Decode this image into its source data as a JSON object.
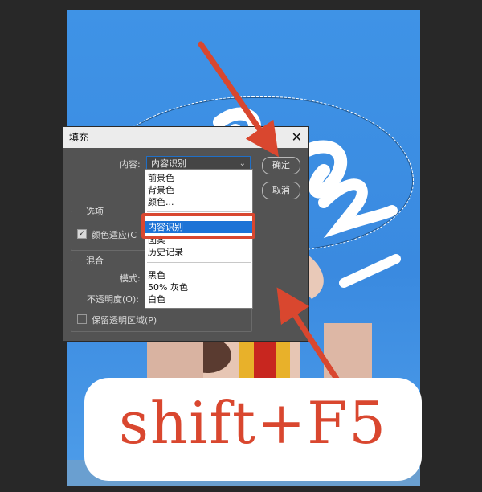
{
  "dialog": {
    "title": "填充",
    "content_label": "内容:",
    "content_value": "内容识别",
    "ok_button": "确定",
    "cancel_button": "取消",
    "options_title": "选项",
    "color_adapt_label": "颜色适应(C",
    "color_adapt_checked": true,
    "blend_title": "混合",
    "mode_label": "模式:",
    "opacity_label": "不透明度(O):",
    "preserve_transparency_label": "保留透明区域(P)",
    "preserve_transparency_checked": false
  },
  "dropdown": {
    "items": [
      "前景色",
      "背景色",
      "颜色...",
      "内容识别",
      "图案",
      "历史记录",
      "黑色",
      "50% 灰色",
      "白色"
    ],
    "selected": "内容识别"
  },
  "annotation": {
    "shortcut_text": "shift+F5",
    "accent_color": "#d9472f"
  },
  "colors": {
    "workspace": "#282828",
    "dialog_bg": "#535353",
    "selection_blue": "#1c73d6",
    "sky_blue": "#3f93e6"
  }
}
